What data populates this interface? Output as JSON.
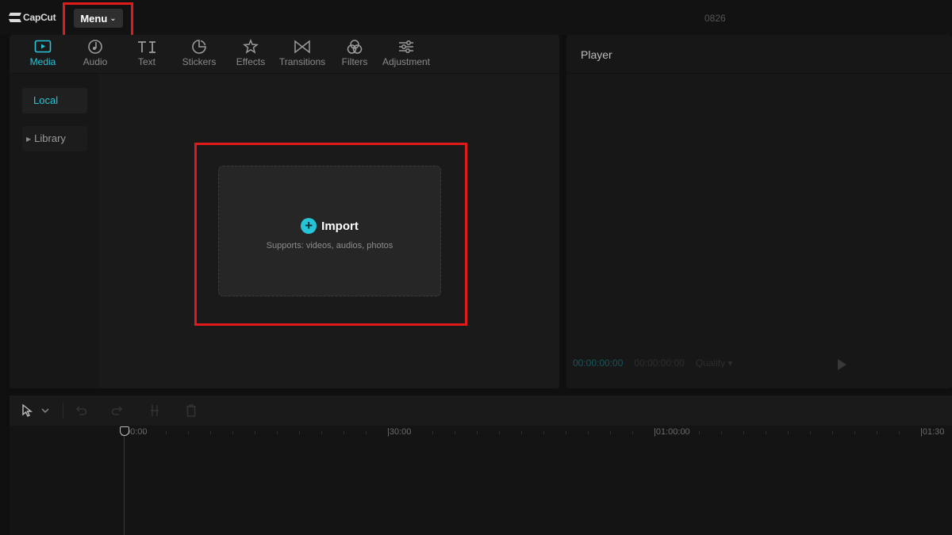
{
  "app": {
    "name": "CapCut",
    "project_name": "0826"
  },
  "menu": {
    "label": "Menu"
  },
  "toolbar": {
    "tabs": [
      {
        "label": "Media",
        "icon": "media-icon",
        "active": true
      },
      {
        "label": "Audio",
        "icon": "audio-icon"
      },
      {
        "label": "Text",
        "icon": "text-icon"
      },
      {
        "label": "Stickers",
        "icon": "stickers-icon"
      },
      {
        "label": "Effects",
        "icon": "effects-icon"
      },
      {
        "label": "Transitions",
        "icon": "transitions-icon"
      },
      {
        "label": "Filters",
        "icon": "filters-icon"
      },
      {
        "label": "Adjustment",
        "icon": "adjustment-icon"
      }
    ]
  },
  "sidebar": {
    "local": "Local",
    "library": "Library"
  },
  "import": {
    "label": "Import",
    "subtitle": "Supports: videos, audios, photos"
  },
  "player": {
    "title": "Player",
    "current_time": "00:00:00:00",
    "total_time": "00:00:00:00",
    "quality": "Quality"
  },
  "timeline": {
    "ruler_labels": [
      "00:00",
      "|30:00",
      "|01:00:00",
      "|01:30"
    ]
  },
  "colors": {
    "accent": "#28c4d8",
    "highlight": "#e01919",
    "background": "#0f0f0f"
  }
}
